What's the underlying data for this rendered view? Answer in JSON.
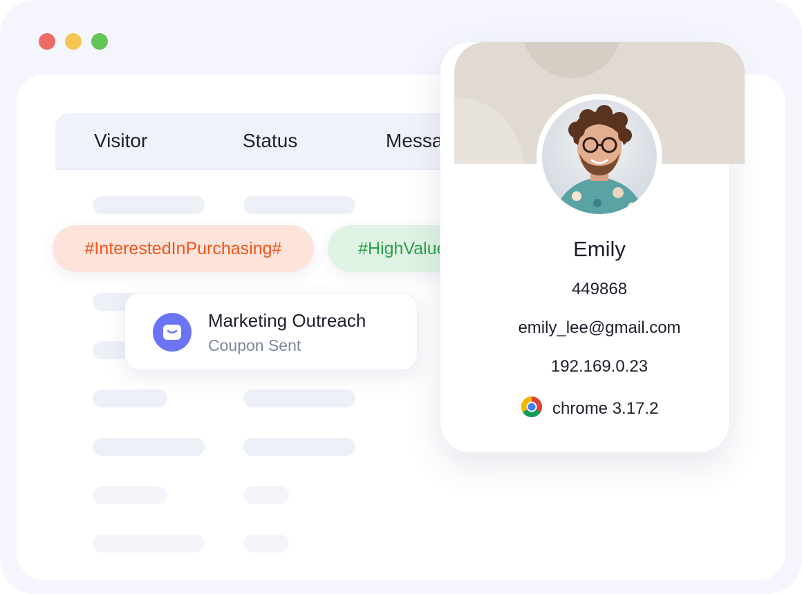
{
  "window": {
    "controls": [
      {
        "name": "close",
        "color": "#ee6a67"
      },
      {
        "name": "minimize",
        "color": "#f5c654"
      },
      {
        "name": "maximize",
        "color": "#62c657"
      }
    ]
  },
  "table": {
    "columns": [
      "Visitor",
      "Status",
      "Messa"
    ]
  },
  "tags": [
    {
      "label": "#InterestedInPurchasing#",
      "color": "#f0561e",
      "bg": "#fde3d9"
    },
    {
      "label": "#HighValueCustomer",
      "color": "#2e9e4c",
      "bg": "#dff3e4"
    }
  ],
  "outreach": {
    "title": "Marketing Outreach",
    "subtitle": "Coupon Sent",
    "icon": "message-icon"
  },
  "profile": {
    "name": "Emily",
    "id": "449868",
    "email": "emily_lee@gmail.com",
    "ip": "192.169.0.23",
    "browser": "chrome 3.17.2",
    "browser_icon": "chrome-icon"
  }
}
